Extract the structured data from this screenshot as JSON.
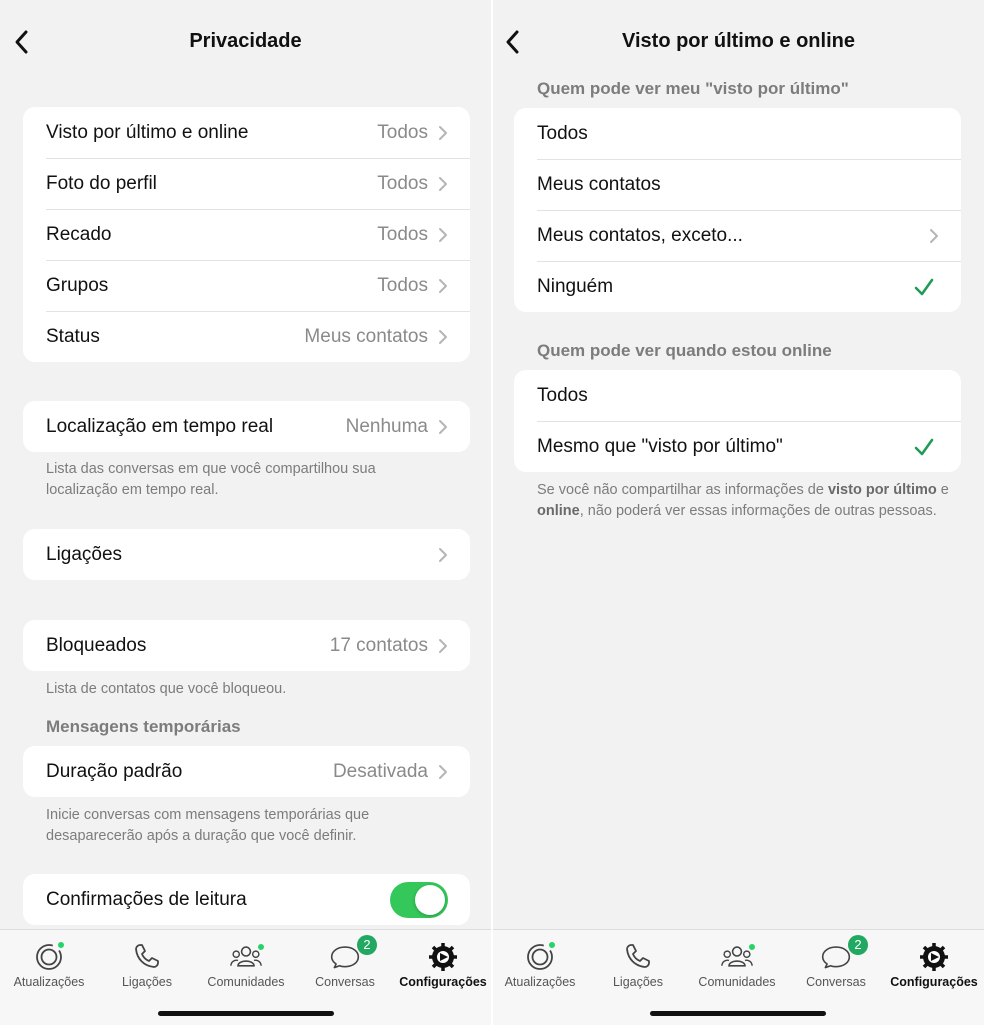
{
  "left_screen": {
    "title": "Privacidade",
    "group1": [
      {
        "label": "Visto por último e online",
        "value": "Todos"
      },
      {
        "label": "Foto do perfil",
        "value": "Todos"
      },
      {
        "label": "Recado",
        "value": "Todos"
      },
      {
        "label": "Grupos",
        "value": "Todos"
      },
      {
        "label": "Status",
        "value": "Meus contatos"
      }
    ],
    "live_location": {
      "label": "Localização em tempo real",
      "value": "Nenhuma"
    },
    "live_location_note": "Lista das conversas em que você compartilhou sua localização em tempo real.",
    "calls": {
      "label": "Ligações"
    },
    "blocked": {
      "label": "Bloqueados",
      "value": "17 contatos"
    },
    "blocked_note": "Lista de contatos que você bloqueou.",
    "temp_section": "Mensagens temporárias",
    "default_duration": {
      "label": "Duração padrão",
      "value": "Desativada"
    },
    "temp_note": "Inicie conversas com mensagens temporárias que desaparecerão após a duração que você definir.",
    "read_receipts": {
      "label": "Confirmações de leitura",
      "enabled": true
    }
  },
  "right_screen": {
    "title": "Visto por último e online",
    "section1": "Quem pode ver meu \"visto por último\"",
    "options1": [
      {
        "label": "Todos",
        "selected": false
      },
      {
        "label": "Meus contatos",
        "selected": false
      },
      {
        "label": "Meus contatos, exceto...",
        "selected": false
      },
      {
        "label": "Ninguém",
        "selected": true
      }
    ],
    "section2": "Quem pode ver quando estou online",
    "options2": [
      {
        "label": "Todos",
        "selected": false
      },
      {
        "label": "Mesmo que \"visto por último\"",
        "selected": true
      }
    ],
    "note": {
      "part1": "Se você não compartilhar as informações de ",
      "bold1": "visto por último",
      "part2": " e ",
      "bold2": "online",
      "part3": ", não poderá ver essas informações de outras pessoas."
    }
  },
  "tabbar": {
    "tabs": [
      {
        "label": "Atualizações",
        "icon": "updates-icon"
      },
      {
        "label": "Ligações",
        "icon": "phone-icon"
      },
      {
        "label": "Comunidades",
        "icon": "communities-icon"
      },
      {
        "label": "Conversas",
        "icon": "chats-icon",
        "badge": "2"
      },
      {
        "label": "Configurações",
        "icon": "settings-icon"
      }
    ],
    "active_tab": "Configurações"
  },
  "colors": {
    "accent_green": "#25d366",
    "check_green": "#1f9d57",
    "toggle_green": "#34c759",
    "background": "#f2f2f2"
  }
}
